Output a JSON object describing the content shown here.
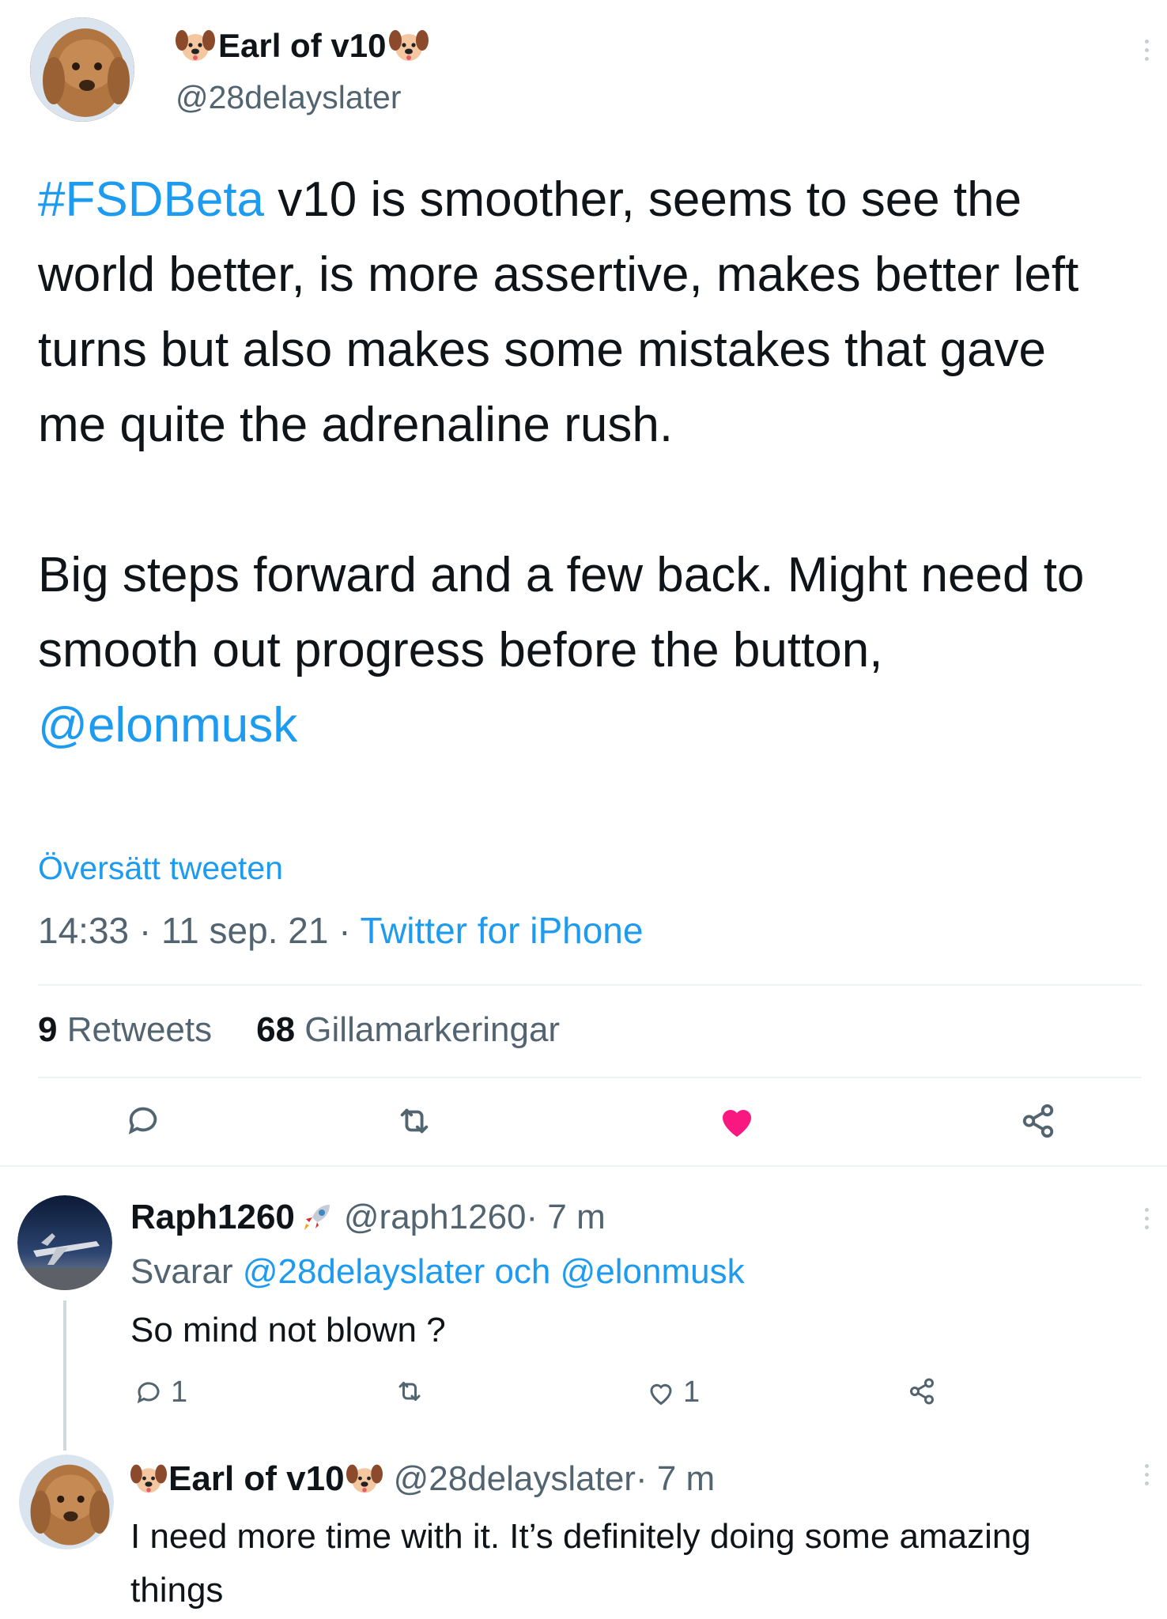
{
  "main_tweet": {
    "author_name": "Earl of v10",
    "name_emoji": "dog-face-icon",
    "handle": "@28delayslater",
    "hashtag": "#FSDBeta",
    "text_para1_after_hashtag": " v10 is smoother, seems to see the world better, is more assertive, makes better left turns but also makes some mistakes that gave me quite the adrenaline rush.",
    "text_para2": "Big steps forward and a few back. Might need to smooth out progress before the button, ",
    "mention": "@elonmusk",
    "translate_link": "Översätt tweeten",
    "time": "14:33",
    "sep1": " · ",
    "date": "11 sep. 21",
    "sep2": " · ",
    "source": "Twitter for iPhone",
    "retweets_count": "9",
    "retweets_label": " Retweets",
    "likes_count": "68",
    "likes_label": " Gillamarkeringar",
    "liked": true
  },
  "replies": [
    {
      "author_name": "Raph1260",
      "name_emoji": "rocket-icon",
      "handle": "@raph1260",
      "age": " · 7 m",
      "replying_prefix": "Svarar ",
      "replying_to_1": "@28delayslater",
      "replying_conj": " och ",
      "replying_to_2": "@elonmusk",
      "text": "So mind not blown ?",
      "reply_count": "1",
      "like_count": "1"
    },
    {
      "author_name": "Earl of v10",
      "name_emoji": "dog-face-icon",
      "handle": "@28delayslater",
      "age": " · 7 m",
      "text": "I need more time with it. It’s definitely doing some amazing things"
    }
  ],
  "colors": {
    "accent": "#1d9bf0",
    "like": "#f91880",
    "text": "#0f1419",
    "secondary": "#536471",
    "divider": "#eff3f4"
  }
}
